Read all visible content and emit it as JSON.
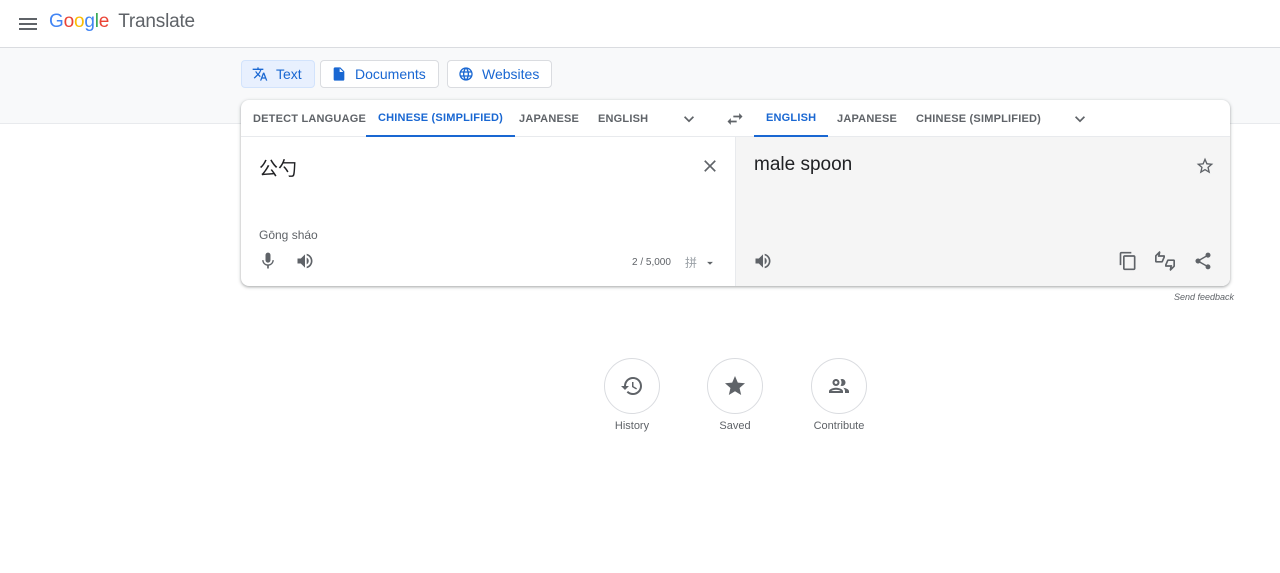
{
  "header": {
    "logo_letters": [
      "G",
      "o",
      "o",
      "g",
      "l",
      "e"
    ],
    "logo_colors": [
      "#4285f4",
      "#ea4335",
      "#fbbc05",
      "#4285f4",
      "#34a853",
      "#ea4335"
    ],
    "product": "Translate"
  },
  "modes": [
    {
      "label": "Text",
      "icon": "translate-icon",
      "active": true
    },
    {
      "label": "Documents",
      "icon": "document-icon",
      "active": false
    },
    {
      "label": "Websites",
      "icon": "globe-icon",
      "active": false
    }
  ],
  "source_langs": [
    "DETECT LANGUAGE",
    "CHINESE (SIMPLIFIED)",
    "JAPANESE",
    "ENGLISH"
  ],
  "source_selected": "CHINESE (SIMPLIFIED)",
  "target_langs": [
    "ENGLISH",
    "JAPANESE",
    "CHINESE (SIMPLIFIED)"
  ],
  "target_selected": "ENGLISH",
  "source": {
    "text": "公勺",
    "romanization": "Gōng sháo",
    "char_count": "2 / 5,000",
    "ime_glyph": "拼"
  },
  "target": {
    "text": "male spoon"
  },
  "feedback": "Send feedback",
  "bottom": [
    {
      "label": "History",
      "icon": "history-icon"
    },
    {
      "label": "Saved",
      "icon": "star-icon"
    },
    {
      "label": "Contribute",
      "icon": "people-icon"
    }
  ],
  "colors": {
    "accent": "#1967d2",
    "text": "#3c4043",
    "muted": "#5f6368"
  }
}
